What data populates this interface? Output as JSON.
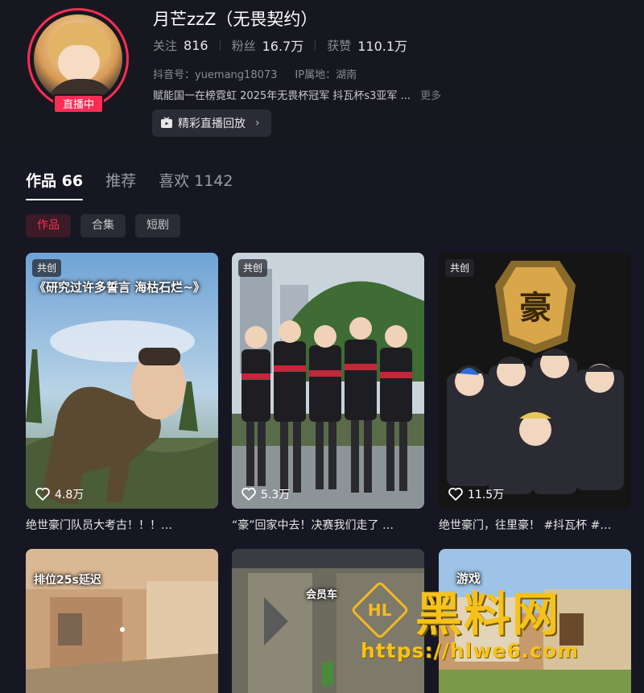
{
  "profile": {
    "username": "月芒zzZ（无畏契约）",
    "live_badge": "直播中",
    "stats": [
      {
        "label": "关注",
        "value": "816"
      },
      {
        "label": "粉丝",
        "value": "16.7万"
      },
      {
        "label": "获赞",
        "value": "110.1万"
      }
    ],
    "douyin_id": "抖音号：yuemang18073",
    "ip_location": "IP属地：湖南",
    "bio": "赋能国一在榜霓虹 2025年无畏杯冠军 抖瓦杯s3亚军 ...",
    "bio_more": "更多",
    "replay_button": "精彩直播回放"
  },
  "tabs": [
    {
      "label": "作品 66"
    },
    {
      "label": "推荐"
    },
    {
      "label": "喜欢 1142"
    }
  ],
  "chips": [
    {
      "label": "作品"
    },
    {
      "label": "合集"
    },
    {
      "label": "短剧"
    }
  ],
  "videos": [
    {
      "tag": "共创",
      "likes": "4.8万",
      "title": "绝世豪门队员大考古！！！…",
      "caption": "《研究过许多誓言 海枯石烂~》"
    },
    {
      "tag": "共创",
      "likes": "5.3万",
      "title": "“豪”回家中去！决赛我们走了 …",
      "caption": ""
    },
    {
      "tag": "共创",
      "likes": "11.5万",
      "title": "绝世豪门，往里豪！ #抖瓦杯 #…",
      "caption": ""
    },
    {
      "tag": "",
      "likes": "",
      "title": "",
      "caption": "排位25s延迟"
    },
    {
      "tag": "",
      "likes": "",
      "title": "",
      "caption": "会员车"
    },
    {
      "tag": "",
      "likes": "",
      "title": "",
      "caption": "游戏"
    }
  ],
  "watermark": {
    "logo": "HL",
    "title": "黑料网",
    "url": "https://hlwe6.com"
  },
  "colors": {
    "accent": "#fe2c55",
    "background": "#161722",
    "watermark": "#f5c21c"
  }
}
